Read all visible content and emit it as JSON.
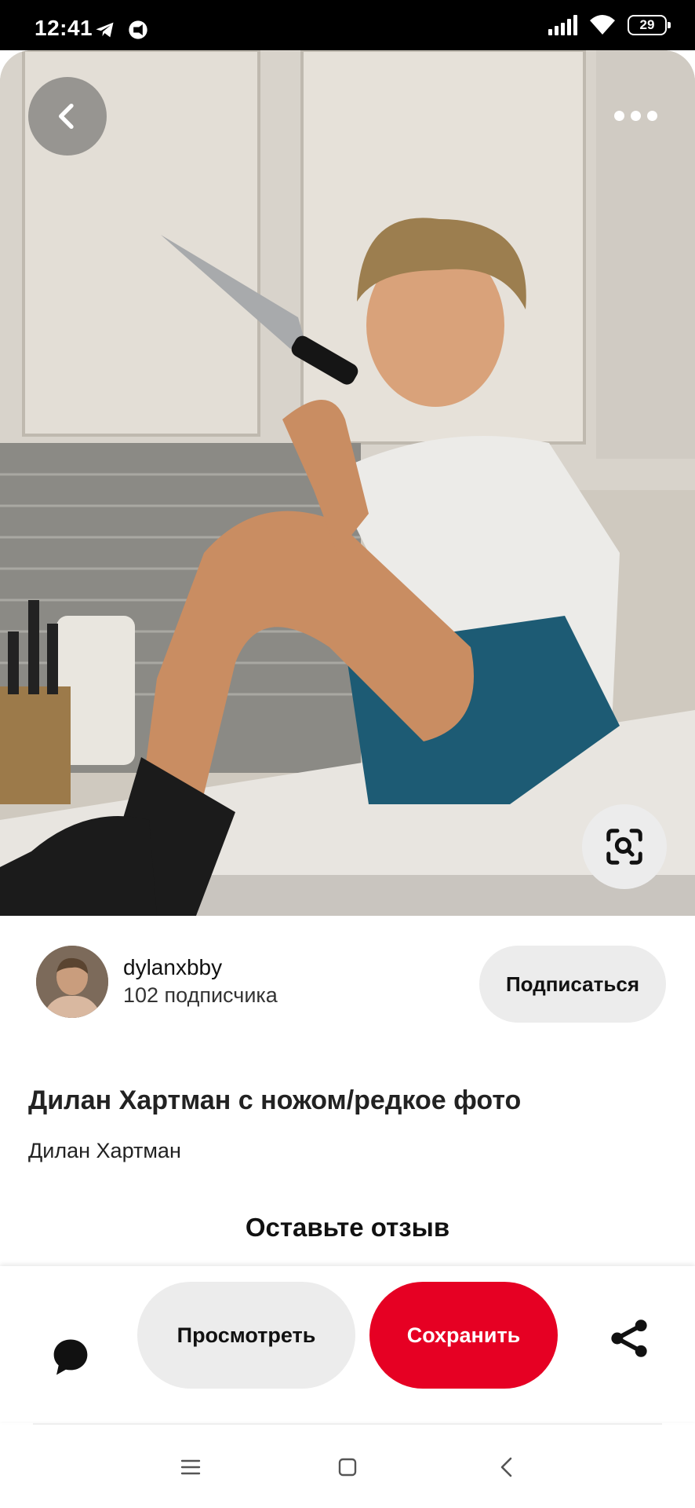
{
  "status_bar": {
    "time": "12:41",
    "battery": "29",
    "icons": [
      "telegram-icon",
      "notification-icon",
      "signal-icon",
      "wifi-icon",
      "battery-icon"
    ]
  },
  "pin": {
    "creator": {
      "name": "dylanxbby",
      "followers": "102 подписчика",
      "follow_label": "Подписаться"
    },
    "title": "Дилан Хартман с ножом/редкое фото",
    "subtitle": "Дилан Хартман",
    "review_heading": "Оставьте отзыв"
  },
  "actions": {
    "view_label": "Просмотреть",
    "save_label": "Сохранить",
    "save_color": "#e60023"
  },
  "icons": {
    "back": "chevron-left-icon",
    "more": "more-horizontal-icon",
    "lens": "visual-search-icon",
    "comment": "comment-bubble-icon",
    "share": "share-icon"
  },
  "nav_bar": [
    "menu-icon",
    "home-icon",
    "back-icon"
  ]
}
